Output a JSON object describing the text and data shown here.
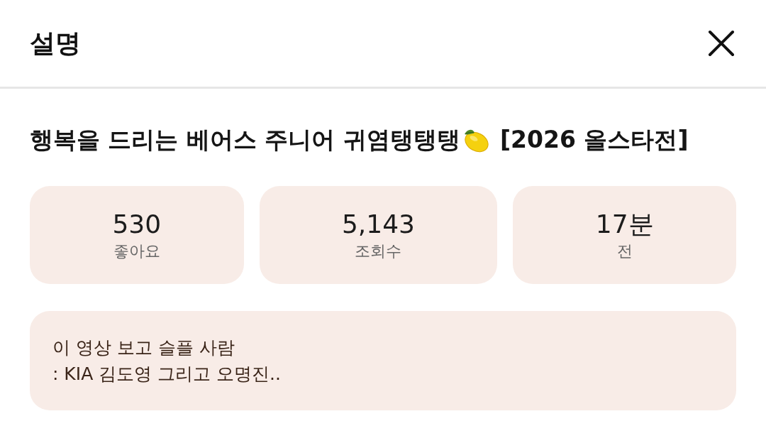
{
  "header": {
    "title": "설명"
  },
  "video_title": {
    "lead": "행복을 드리는 베어스 주니어 귀염탱탱탱",
    "tail": "[2026 올스타전]"
  },
  "stats": [
    {
      "value": "530",
      "label": "좋아요"
    },
    {
      "value": "5,143",
      "label": "조회수"
    },
    {
      "value": "17분",
      "label": "전"
    }
  ],
  "description": "이 영상 보고 슬플 사람\n: KIA 김도영 그리고 오명진.."
}
